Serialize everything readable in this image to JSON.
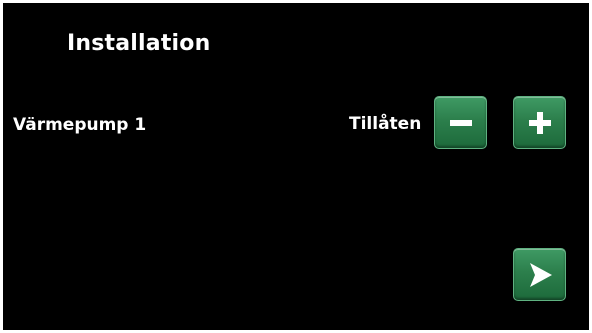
{
  "screen": {
    "title": "Installation"
  },
  "setting": {
    "label": "Värmepump 1",
    "value": "Tillåten"
  },
  "controls": {
    "decrease_icon": "minus-icon",
    "increase_icon": "plus-icon",
    "next_icon": "play-arrow-icon"
  },
  "colors": {
    "background": "#000000",
    "text": "#ffffff",
    "button_green": "#2c7f4c"
  }
}
